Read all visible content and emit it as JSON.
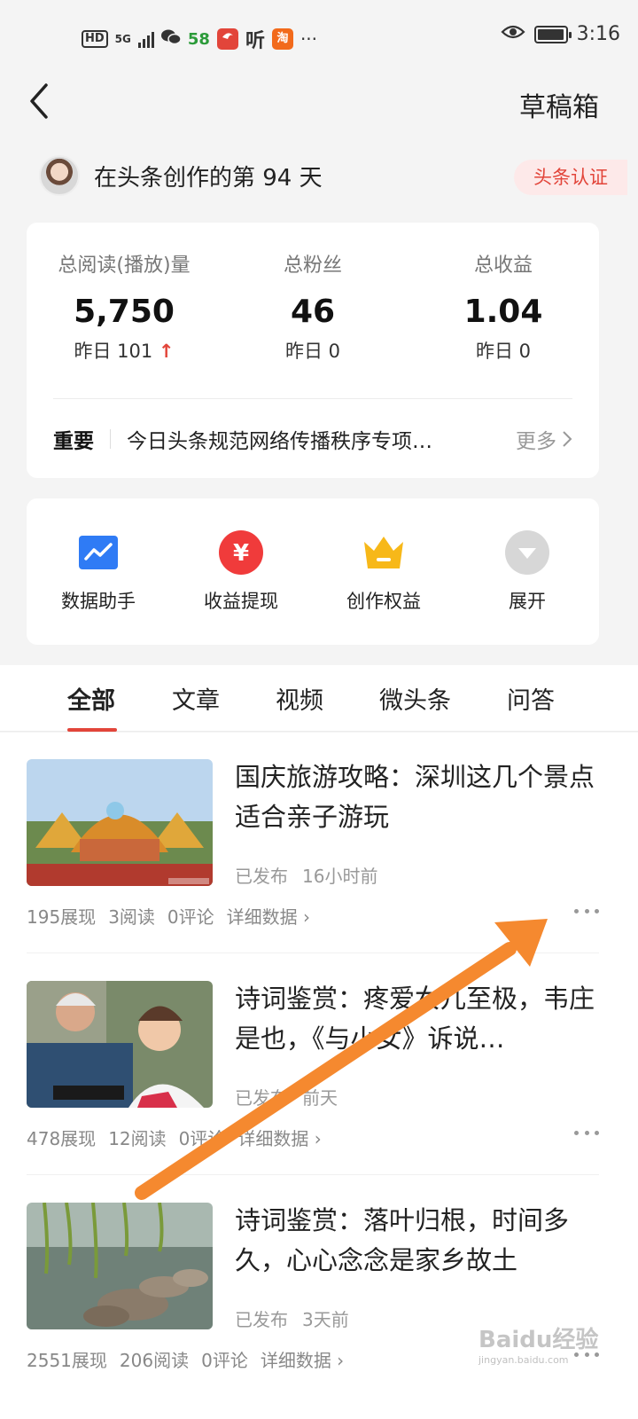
{
  "status_bar": {
    "hd": "HD",
    "network": "5G",
    "app_58": "58",
    "app_ting": "听",
    "app_tao": "淘",
    "ellipsis": "···",
    "time": "3:16"
  },
  "header": {
    "draft_label": "草稿箱"
  },
  "profile": {
    "text": "在头条创作的第 94 天",
    "cert_label": "头条认证"
  },
  "stats": [
    {
      "label": "总阅读(播放)量",
      "value": "5,750",
      "yesterday": "昨日 101",
      "trend_up": true
    },
    {
      "label": "总粉丝",
      "value": "46",
      "yesterday": "昨日 0"
    },
    {
      "label": "总收益",
      "value": "1.04",
      "yesterday": "昨日 0"
    }
  ],
  "notice": {
    "tag": "重要",
    "text": "今日头条规范网络传播秩序专项…",
    "more": "更多"
  },
  "tools": [
    {
      "label": "数据助手",
      "icon": "chart-icon"
    },
    {
      "label": "收益提现",
      "icon": "yuan-icon"
    },
    {
      "label": "创作权益",
      "icon": "crown-icon"
    },
    {
      "label": "展开",
      "icon": "expand-icon"
    }
  ],
  "tabs": [
    "全部",
    "文章",
    "视频",
    "微头条",
    "问答"
  ],
  "articles": [
    {
      "title": "国庆旅游攻略：深圳这几个景点适合亲子游玩",
      "status": "已发布",
      "time": "16小时前",
      "views": "195展现",
      "reads": "3阅读",
      "comments": "0评论",
      "detail": "详细数据"
    },
    {
      "title": "诗词鉴赏：疼爱女儿至极，韦庄是也，《与小女》诉说…",
      "status": "已发布",
      "time": "前天",
      "views": "478展现",
      "reads": "12阅读",
      "comments": "0评论",
      "detail": "详细数据"
    },
    {
      "title": "诗词鉴赏：落叶归根，时间多久，心心念念是家乡故土",
      "status": "已发布",
      "time": "3天前",
      "views": "2551展现",
      "reads": "206阅读",
      "comments": "0评论",
      "detail": "详细数据"
    }
  ],
  "watermark": {
    "text": "Baidu经验",
    "url": "jingyan.baidu.com"
  },
  "colors": {
    "accent": "#e2453a",
    "chart_blue": "#2f7bf5",
    "crown_gold": "#f7b819",
    "arrow_orange": "#f5892f"
  }
}
